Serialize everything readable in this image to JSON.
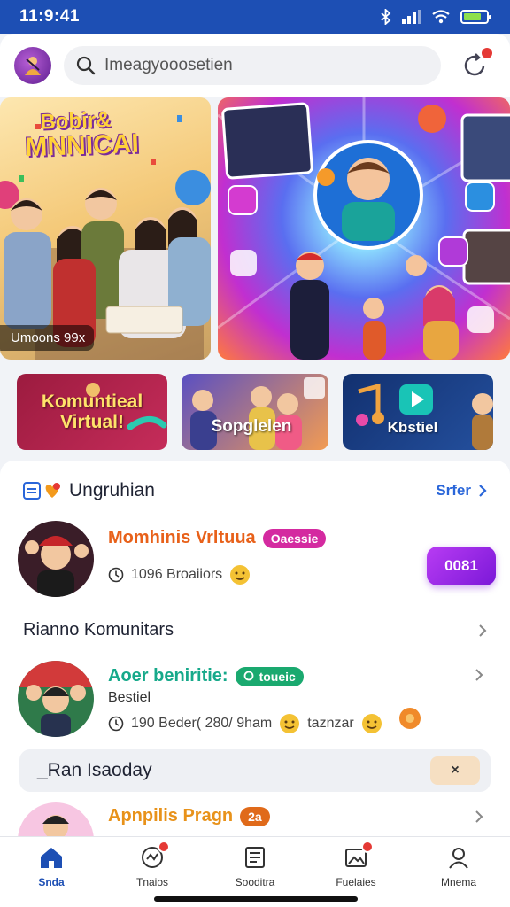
{
  "status_bar": {
    "time": "11:9:41"
  },
  "header": {
    "search_placeholder": "Imeagyooosetien"
  },
  "banners": {
    "left_title_line1": "Bobir&",
    "left_title_line2": "MNNICAI",
    "left_caption": "Umoons 99x"
  },
  "categories": [
    {
      "label": "Komuntieal Virtual!"
    },
    {
      "label": "Sopglelen"
    },
    {
      "label": "Kbstiel"
    }
  ],
  "section": {
    "title": "Ungruhian",
    "see_all": "Srfer"
  },
  "item1": {
    "title": "Momhinis Vrltuua",
    "badge": "Oaessie",
    "meta": "1096 Broaiiors",
    "action": "0081"
  },
  "row2": {
    "title": "Rianno Komunitars"
  },
  "item2": {
    "title": "Aoer beniritie:",
    "badge": "toueic",
    "subtitle": "Bestiel",
    "meta1": "190 Beder( 280/ 9ham",
    "meta2": "taznzar"
  },
  "strip": {
    "title": "_Ran Isaoday",
    "button": "×"
  },
  "item3": {
    "title": "Apnpilis Pragn",
    "badge": "2a"
  },
  "nav": [
    {
      "label": "Snda"
    },
    {
      "label": "Tnaios"
    },
    {
      "label": "Sooditra"
    },
    {
      "label": "Fuelaies"
    },
    {
      "label": "Mnema"
    }
  ],
  "colors": {
    "brand": "#1d4fb4",
    "accent_purple": "#8a1fe0",
    "title_orange": "#e8611a",
    "title_teal": "#16a98a"
  }
}
